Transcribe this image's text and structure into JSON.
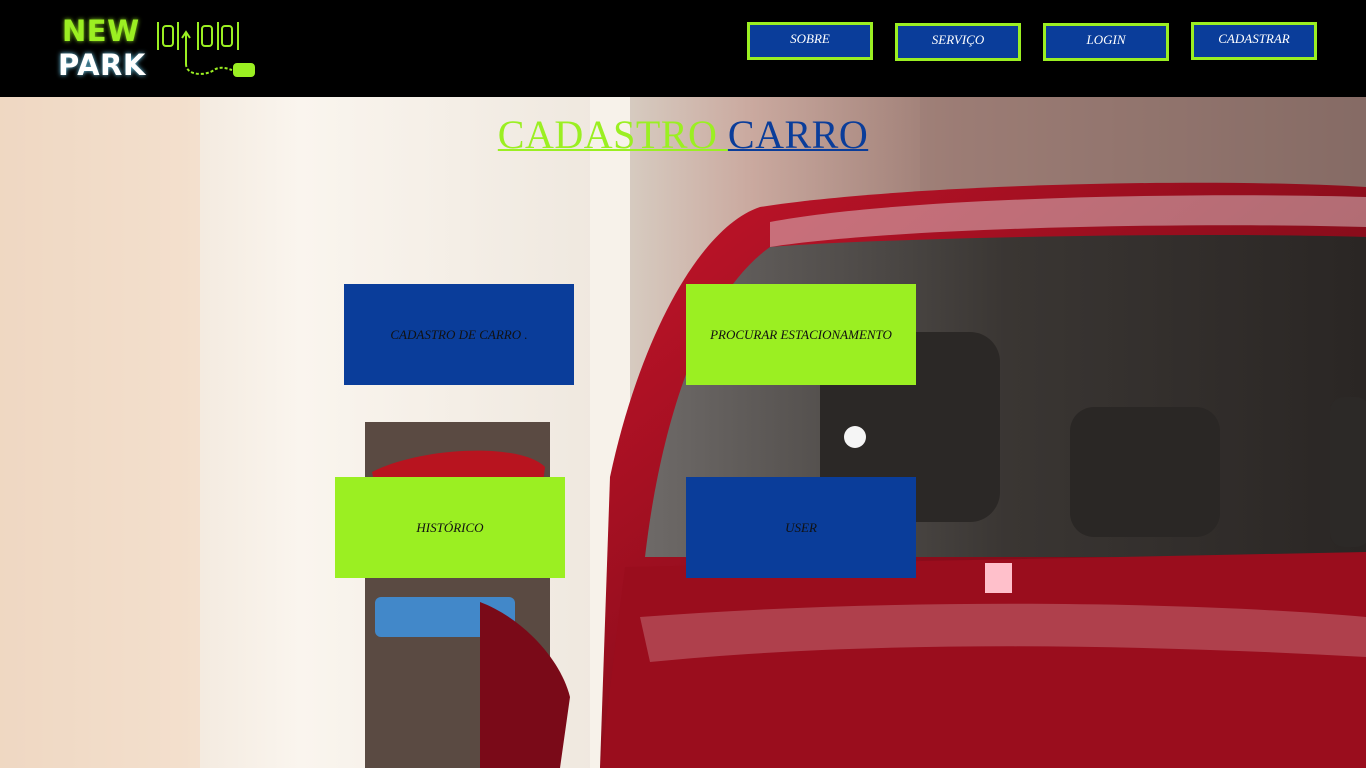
{
  "logo": {
    "line1": "NEW",
    "line2": "PARK"
  },
  "nav": [
    {
      "label": "SOBRE"
    },
    {
      "label": "SERVIÇO"
    },
    {
      "label": "LOGIN"
    },
    {
      "label": "CADASTRAR"
    }
  ],
  "page_title": {
    "part1": "CADASTRO ",
    "part2": "CARRO"
  },
  "tiles": [
    {
      "label": "CADASTRO DE CARRO ."
    },
    {
      "label": "PROCURAR ESTACIONAMENTO"
    },
    {
      "label": "HISTÓRICO"
    },
    {
      "label": "USER"
    }
  ],
  "colors": {
    "brand_green": "#9bef22",
    "brand_blue": "#0a3d9a",
    "header_bg": "#000000",
    "accent_pink": "#ffc0cb"
  }
}
